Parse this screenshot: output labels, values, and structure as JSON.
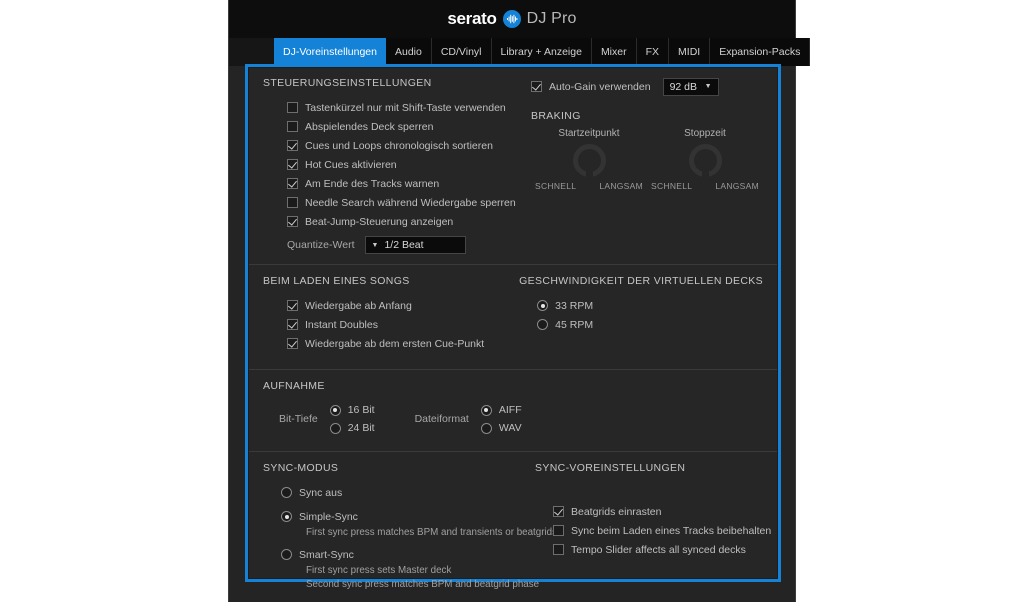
{
  "window": {
    "logo_text": "serato",
    "logo_mark_icon": "serato-waveform-icon",
    "logo_suffix": "DJ Pro",
    "accent_color": "#1482d6"
  },
  "tabs": [
    {
      "label": "DJ-Voreinstellungen",
      "active": true
    },
    {
      "label": "Audio",
      "active": false
    },
    {
      "label": "CD/Vinyl",
      "active": false
    },
    {
      "label": "Library + Anzeige",
      "active": false
    },
    {
      "label": "Mixer",
      "active": false
    },
    {
      "label": "FX",
      "active": false
    },
    {
      "label": "MIDI",
      "active": false
    },
    {
      "label": "Expansion-Packs",
      "active": false
    }
  ],
  "control_settings": {
    "title": "STEUERUNGSEINSTELLUNGEN",
    "checkboxes": [
      {
        "label": "Tastenkürzel nur mit Shift-Taste verwenden",
        "checked": false
      },
      {
        "label": "Abspielendes Deck sperren",
        "checked": false
      },
      {
        "label": "Cues und Loops chronologisch sortieren",
        "checked": true
      },
      {
        "label": "Hot Cues aktivieren",
        "checked": true
      },
      {
        "label": "Am Ende des Tracks warnen",
        "checked": true
      },
      {
        "label": "Needle Search während Wiedergabe sperren",
        "checked": false
      },
      {
        "label": "Beat-Jump-Steuerung anzeigen",
        "checked": true
      }
    ],
    "quantize_label": "Quantize-Wert",
    "quantize_value": "1/2 Beat",
    "auto_gain": {
      "label": "Auto-Gain verwenden",
      "checked": true
    },
    "auto_gain_value": "92 dB"
  },
  "braking": {
    "title": "BRAKING",
    "knobs": [
      {
        "caption": "Startzeitpunkt",
        "tick_min": "SCHNELL",
        "tick_max": "LANGSAM"
      },
      {
        "caption": "Stoppzeit",
        "tick_min": "SCHNELL",
        "tick_max": "LANGSAM"
      }
    ]
  },
  "on_song_load": {
    "title": "BEIM LADEN EINES SONGS",
    "checkboxes": [
      {
        "label": "Wiedergabe ab Anfang",
        "checked": true
      },
      {
        "label": "Instant Doubles",
        "checked": true
      },
      {
        "label": "Wiedergabe ab dem ersten Cue-Punkt",
        "checked": true
      }
    ]
  },
  "deck_speed": {
    "title": "GESCHWINDIGKEIT DER VIRTUELLEN DECKS",
    "options": [
      {
        "label": "33 RPM",
        "selected": true
      },
      {
        "label": "45 RPM",
        "selected": false
      }
    ]
  },
  "recording": {
    "title": "AUFNAHME",
    "bit_depth_label": "Bit-Tiefe",
    "bit_depth_options": [
      {
        "label": "16 Bit",
        "selected": true
      },
      {
        "label": "24 Bit",
        "selected": false
      }
    ],
    "file_format_label": "Dateiformat",
    "file_format_options": [
      {
        "label": "AIFF",
        "selected": true
      },
      {
        "label": "WAV",
        "selected": false
      }
    ]
  },
  "sync_mode": {
    "title": "SYNC-MODUS",
    "options": [
      {
        "label": "Sync aus",
        "selected": false,
        "desc": []
      },
      {
        "label": "Simple-Sync",
        "selected": true,
        "desc": [
          "First sync press matches BPM and transients or beatgrids"
        ]
      },
      {
        "label": "Smart-Sync",
        "selected": false,
        "desc": [
          "First sync press sets Master deck",
          "Second sync press matches BPM and beatgrid phase"
        ]
      }
    ]
  },
  "sync_preferences": {
    "title": "SYNC-VOREINSTELLUNGEN",
    "checkboxes": [
      {
        "label": "Beatgrids einrasten",
        "checked": true
      },
      {
        "label": "Sync beim Laden eines Tracks beibehalten",
        "checked": false
      },
      {
        "label": "Tempo Slider affects all synced decks",
        "checked": false
      }
    ]
  }
}
